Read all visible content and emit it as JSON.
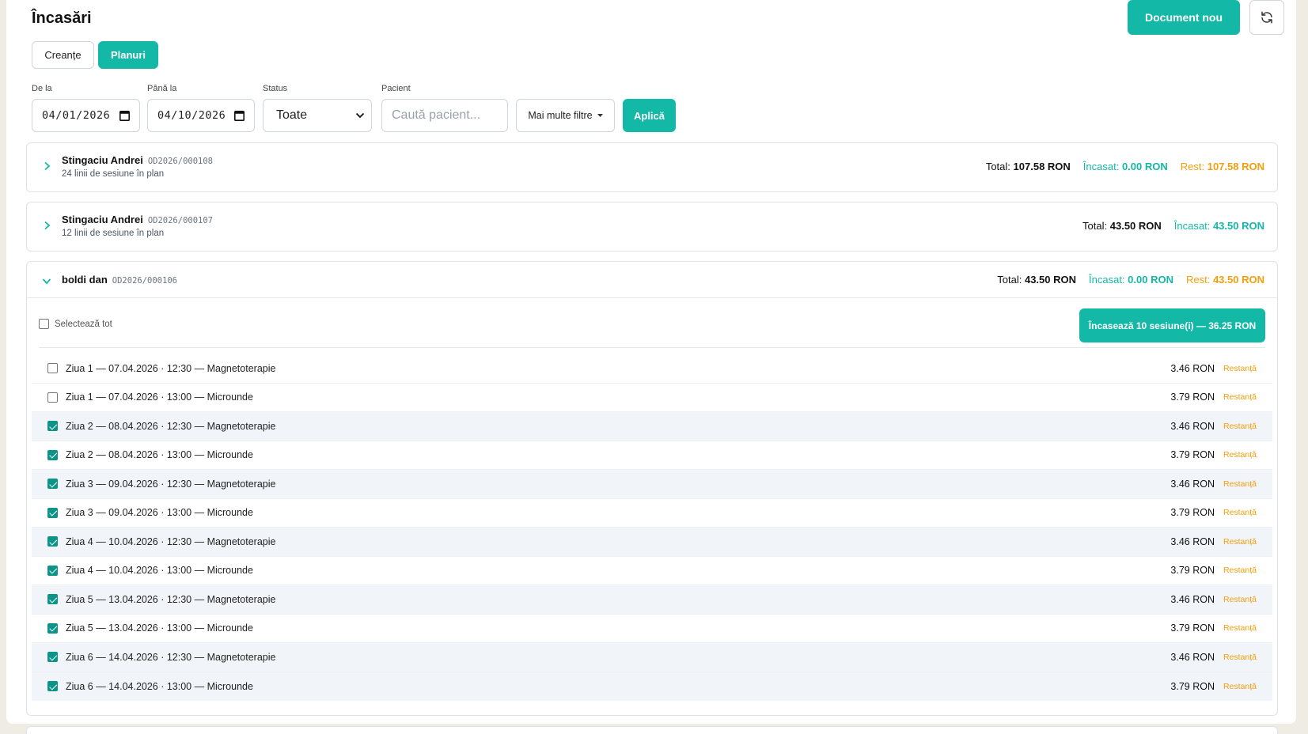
{
  "header": {
    "title": "Încasări",
    "new_document": "Document nou"
  },
  "tabs": [
    {
      "label": "Creanțe",
      "active": false
    },
    {
      "label": "Planuri",
      "active": true
    }
  ],
  "filters": {
    "from_label": "De la",
    "from_value": "04/01/2026",
    "to_label": "Până la",
    "to_value": "04/10/2026",
    "status_label": "Status",
    "status_value": "Toate",
    "patient_label": "Pacient",
    "patient_placeholder": "Caută pacient...",
    "more_filters": "Mai multe filtre",
    "apply": "Aplică"
  },
  "plans": [
    {
      "patient": "Stingaciu Andrei",
      "code": "OD2026/000108",
      "subtitle": "24 linii de sesiune în plan",
      "total_label": "Total:",
      "total": "107.58 RON",
      "paid_label": "Încasat:",
      "paid": "0.00 RON",
      "rest_label": "Rest:",
      "rest": "107.58 RON"
    },
    {
      "patient": "Stingaciu Andrei",
      "code": "OD2026/000107",
      "subtitle": "12 linii de sesiune în plan",
      "total_label": "Total:",
      "total": "43.50 RON",
      "paid_label": "Încasat:",
      "paid": "43.50 RON"
    },
    {
      "patient": "boldi dan",
      "code": "OD2026/000106",
      "total_label": "Total:",
      "total": "43.50 RON",
      "paid_label": "Încasat:",
      "paid": "0.00 RON",
      "rest_label": "Rest:",
      "rest": "43.50 RON",
      "select_all": "Selectează tot",
      "collect_button": "Încasează 10 sesiune(i) — 36.25 RON",
      "sessions": [
        {
          "desc": "Ziua 1 — 07.04.2026 · 12:30 — Magnetoterapie",
          "amount": "3.46 RON",
          "status": "Restanță",
          "checked": false
        },
        {
          "desc": "Ziua 1 — 07.04.2026 · 13:00 — Microunde",
          "amount": "3.79 RON",
          "status": "Restanță",
          "checked": false
        },
        {
          "desc": "Ziua 2 — 08.04.2026 · 12:30 — Magnetoterapie",
          "amount": "3.46 RON",
          "status": "Restanță",
          "checked": true
        },
        {
          "desc": "Ziua 2 — 08.04.2026 · 13:00 — Microunde",
          "amount": "3.79 RON",
          "status": "Restanță",
          "checked": true
        },
        {
          "desc": "Ziua 3 — 09.04.2026 · 12:30 — Magnetoterapie",
          "amount": "3.46 RON",
          "status": "Restanță",
          "checked": true
        },
        {
          "desc": "Ziua 3 — 09.04.2026 · 13:00 — Microunde",
          "amount": "3.79 RON",
          "status": "Restanță",
          "checked": true
        },
        {
          "desc": "Ziua 4 — 10.04.2026 · 12:30 — Magnetoterapie",
          "amount": "3.46 RON",
          "status": "Restanță",
          "checked": true
        },
        {
          "desc": "Ziua 4 — 10.04.2026 · 13:00 — Microunde",
          "amount": "3.79 RON",
          "status": "Restanță",
          "checked": true
        },
        {
          "desc": "Ziua 5 — 13.04.2026 · 12:30 — Magnetoterapie",
          "amount": "3.46 RON",
          "status": "Restanță",
          "checked": true
        },
        {
          "desc": "Ziua 5 — 13.04.2026 · 13:00 — Microunde",
          "amount": "3.79 RON",
          "status": "Restanță",
          "checked": true
        },
        {
          "desc": "Ziua 6 — 14.04.2026 · 12:30 — Magnetoterapie",
          "amount": "3.46 RON",
          "status": "Restanță",
          "checked": true
        },
        {
          "desc": "Ziua 6 — 14.04.2026 · 13:00 — Microunde",
          "amount": "3.79 RON",
          "status": "Restanță",
          "checked": true
        }
      ]
    }
  ],
  "icons": {
    "refresh": "refresh-icon",
    "calendar": "calendar-icon",
    "chevron_right": "chevron-right-icon",
    "chevron_down": "chevron-down-icon",
    "caret_down": "caret-down-icon"
  },
  "colors": {
    "accent": "#14b8a6",
    "paid": "#14b8a6",
    "rest": "#f59e0b",
    "checked": "#0d9488"
  }
}
